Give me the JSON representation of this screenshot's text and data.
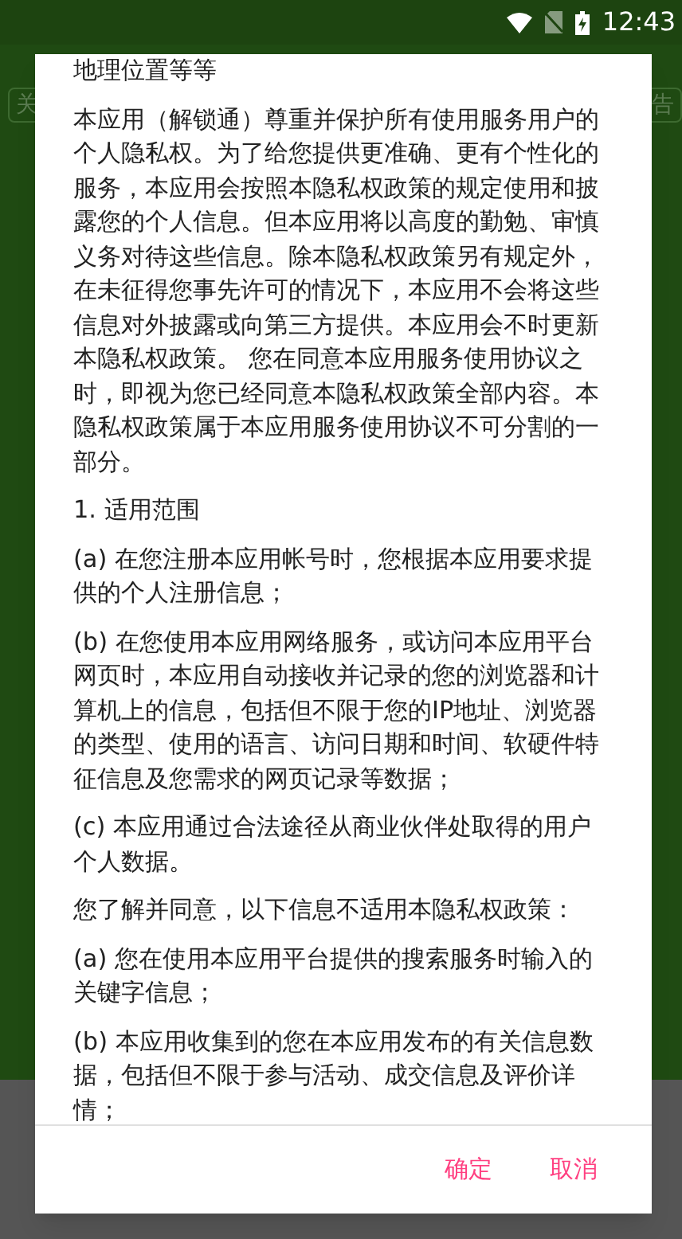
{
  "status_bar": {
    "time": "12:43"
  },
  "background": {
    "left_button": "关",
    "right_button": "告"
  },
  "dialog": {
    "paragraphs": [
      "地理位置等等",
      "本应用（解锁通）尊重并保护所有使用服务用户的个人隐私权。为了给您提供更准确、更有个性化的服务，本应用会按照本隐私权政策的规定使用和披露您的个人信息。但本应用将以高度的勤勉、审慎义务对待这些信息。除本隐私权政策另有规定外，在未征得您事先许可的情况下，本应用不会将这些信息对外披露或向第三方提供。本应用会不时更新本隐私权政策。 您在同意本应用服务使用协议之时，即视为您已经同意本隐私权政策全部内容。本隐私权政策属于本应用服务使用协议不可分割的一部分。",
      "1. 适用范围",
      "(a) 在您注册本应用帐号时，您根据本应用要求提供的个人注册信息；",
      "(b) 在您使用本应用网络服务，或访问本应用平台网页时，本应用自动接收并记录的您的浏览器和计算机上的信息，包括但不限于您的IP地址、浏览器的类型、使用的语言、访问日期和时间、软硬件特征信息及您需求的网页记录等数据；",
      "(c) 本应用通过合法途径从商业伙伴处取得的用户个人数据。",
      "您了解并同意，以下信息不适用本隐私权政策：",
      "(a) 您在使用本应用平台提供的搜索服务时输入的关键字信息；",
      "(b) 本应用收集到的您在本应用发布的有关信息数据，包括但不限于参与活动、成交信息及评价详情；"
    ],
    "buttons": [
      "确定",
      "取消"
    ]
  }
}
